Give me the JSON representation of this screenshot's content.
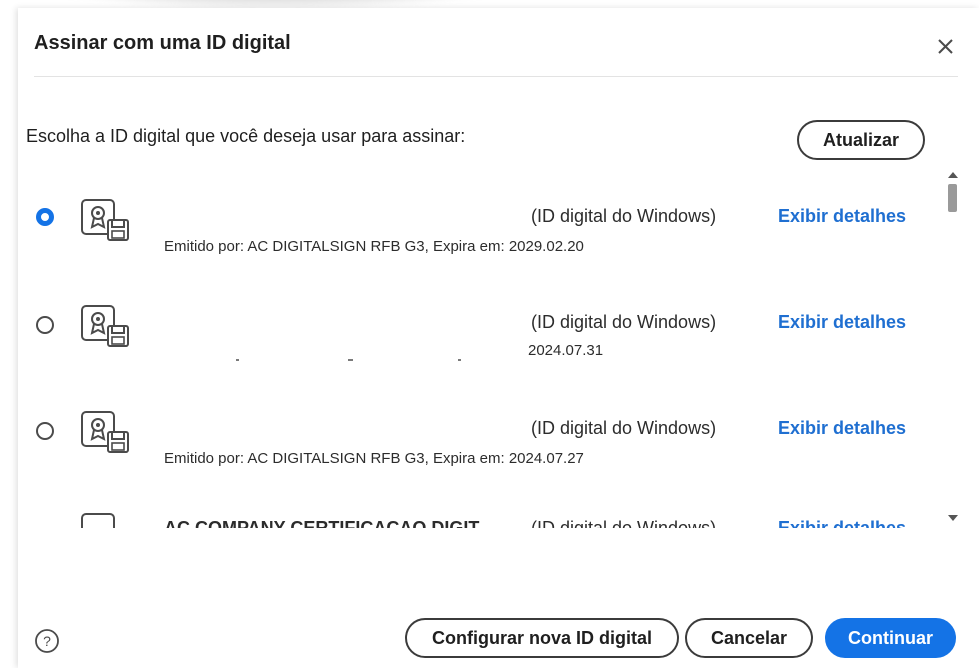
{
  "dialog": {
    "title": "Assinar com uma ID digital",
    "close_icon": "close-icon",
    "prompt": "Escolha a ID digital que você deseja usar para assinar:",
    "refresh_label": "Atualizar"
  },
  "certificates": [
    {
      "selected": true,
      "type": "(ID digital do Windows)",
      "details_label": "Exibir detalhes",
      "issuer": "Emitido por: AC DIGITALSIGN RFB G3, Expira em: 2029.02.20",
      "icon": "certificate-icon"
    },
    {
      "selected": false,
      "type": "(ID digital do Windows)",
      "details_label": "Exibir detalhes",
      "issuer": "2024.07.31",
      "icon": "certificate-icon"
    },
    {
      "selected": false,
      "type": "(ID digital do Windows)",
      "details_label": "Exibir detalhes",
      "issuer": "Emitido por: AC DIGITALSIGN RFB G3, Expira em: 2024.07.27",
      "icon": "certificate-icon"
    },
    {
      "selected": false,
      "name": "AC COMPANY CERTIFICACAO DIGIT...",
      "type": "(ID digital do Windows)",
      "details_label": "Exibir detalhes",
      "icon": "certificate-icon"
    }
  ],
  "footer": {
    "help_icon": "help-icon",
    "setup_label": "Configurar nova ID digital",
    "cancel_label": "Cancelar",
    "continue_label": "Continuar"
  },
  "colors": {
    "accent": "#1473e6",
    "link": "#1f6fd1",
    "text": "#1f1f1f"
  }
}
